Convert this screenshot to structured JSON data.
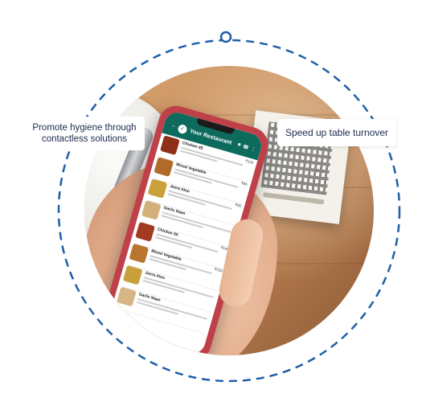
{
  "labels": {
    "left": "Promote hygiene through contactless solutions",
    "right": "Speed up  table turnover"
  },
  "phone_app": {
    "header_title": "Your Restaurant",
    "back_icon": "arrow-left-icon",
    "video_icon": "video-camera-icon",
    "call_icon": "phone-icon",
    "more_icon": "more-vertical-icon",
    "menu_items": [
      {
        "name": "Chicken 65",
        "price": "₹120",
        "color": "#8e2f18"
      },
      {
        "name": "Mixed Vegetable",
        "price": "₹90",
        "color": "#b06b2b"
      },
      {
        "name": "Jeera Aloo",
        "price": "₹90",
        "color": "#c9a03a"
      },
      {
        "name": "Garlic Naan",
        "price": "",
        "color": "#d3b07a"
      },
      {
        "name": "Chicken 65",
        "price": "₹140",
        "color": "#a13a1e"
      },
      {
        "name": "Mixed Vegetable",
        "price": "₹150",
        "color": "#b97430"
      },
      {
        "name": "Jeera Aloo",
        "price": "",
        "color": "#c8a03b"
      },
      {
        "name": "Garlic Naan",
        "price": "",
        "color": "#d7b585"
      }
    ]
  },
  "colors": {
    "ring": "#1e5fa8",
    "label_text": "#1b2c4e",
    "app_header": "#0d6b5e",
    "phone_case": "#c0404a"
  }
}
